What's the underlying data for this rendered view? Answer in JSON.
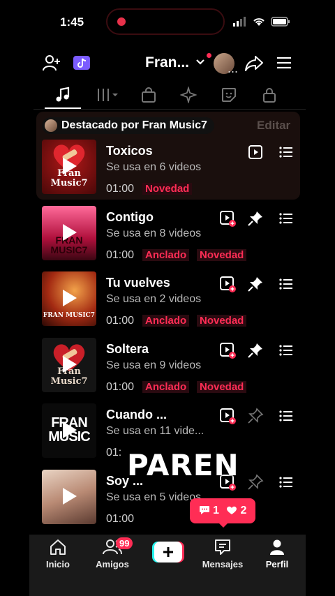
{
  "status": {
    "time": "1:45"
  },
  "header": {
    "name": "Fran...",
    "more": "..."
  },
  "featured": {
    "label": "Destacado por Fran Music7",
    "edit_label": "Editar"
  },
  "songs": [
    {
      "title": "Toxicos",
      "uses": "Se usa en 6 videos",
      "duration": "01:00",
      "badges": [
        "Novedad"
      ],
      "pinned": false,
      "thumb_text": "Fran Music7"
    },
    {
      "title": "Contigo",
      "uses": "Se usa en 8 videos",
      "duration": "01:00",
      "badges": [
        "Anclado",
        "Novedad"
      ],
      "pinned": true,
      "thumb_text": "FRAN MUSIC7"
    },
    {
      "title": "Tu vuelves",
      "uses": "Se usa en 2 videos",
      "duration": "01:00",
      "badges": [
        "Anclado",
        "Novedad"
      ],
      "pinned": true,
      "thumb_text": "FRAN MUSIC7"
    },
    {
      "title": "Soltera",
      "uses": "Se usa en 9 videos",
      "duration": "01:00",
      "badges": [
        "Anclado",
        "Novedad"
      ],
      "pinned": true,
      "thumb_text": "Fran Music7"
    },
    {
      "title": "Cuando ...",
      "uses": "Se usa en 11 vide...",
      "duration": "01:",
      "badges": [],
      "pinned": false,
      "thumb_text": "FRAN MUSIC"
    },
    {
      "title": "Soy ...",
      "uses": "Se usa en 5 videos",
      "duration": "01:00",
      "badges": [],
      "pinned": false,
      "thumb_text": ""
    }
  ],
  "overlay": {
    "text": "PAREN"
  },
  "notification": {
    "comments": "1",
    "likes": "2"
  },
  "nav": {
    "items": [
      {
        "label": "Inicio",
        "icon": "home-icon"
      },
      {
        "label": "Amigos",
        "icon": "friends-icon",
        "badge": "99"
      },
      {
        "label": "",
        "icon": "create-icon"
      },
      {
        "label": "Mensajes",
        "icon": "inbox-icon"
      },
      {
        "label": "Perfil",
        "icon": "profile-icon"
      }
    ]
  },
  "colors": {
    "accent": "#ff2d55",
    "background": "#000000"
  }
}
